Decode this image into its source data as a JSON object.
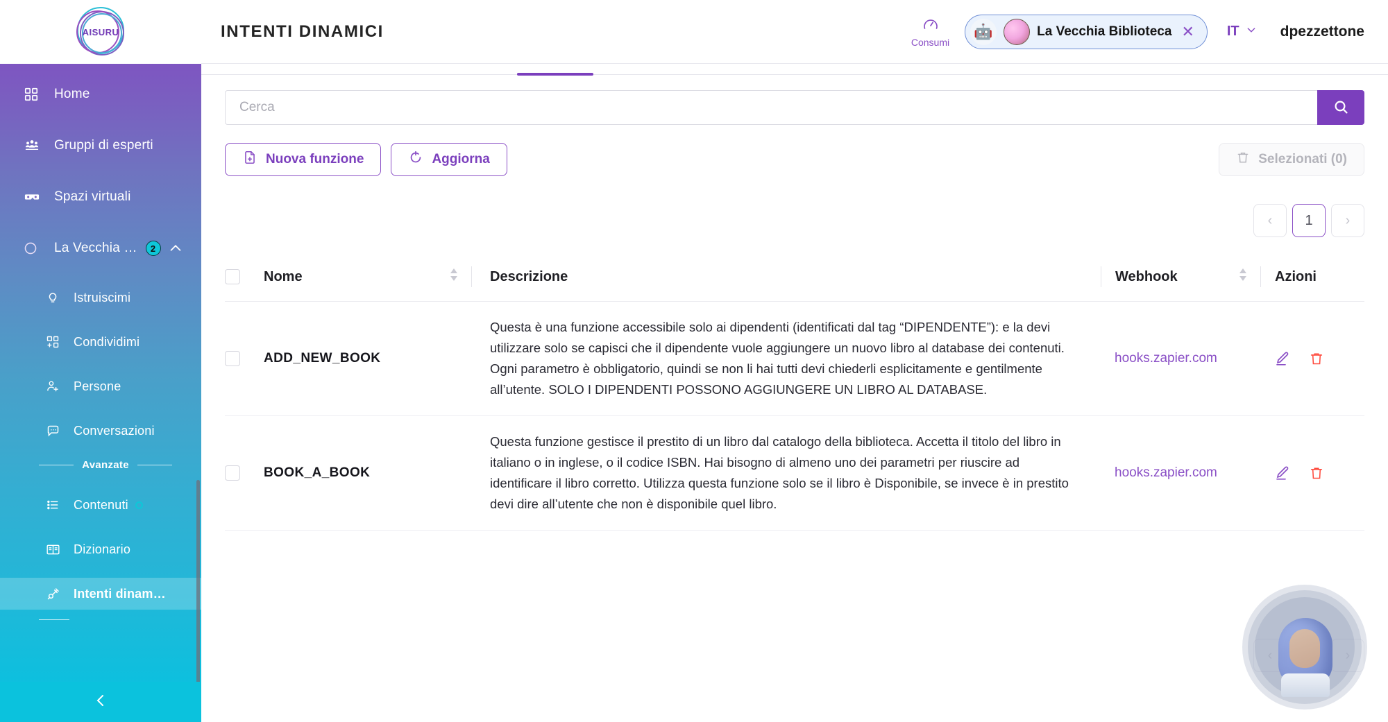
{
  "brand": {
    "logo_text": "AISURU",
    "accent_purple": "#7b3fbd",
    "accent_cyan": "#0ec7d9"
  },
  "header": {
    "title": "INTENTI DINAMICI",
    "consumi_label": "Consumi",
    "agent_name": "La Vecchia Biblioteca",
    "chip_close": "✕",
    "language": "IT",
    "user": "dpezzettone"
  },
  "sidebar": {
    "items": [
      {
        "label": "Home",
        "icon": "grid-icon"
      },
      {
        "label": "Gruppi di esperti",
        "icon": "people-group-icon"
      },
      {
        "label": "Spazi virtuali",
        "icon": "vr-goggles-icon"
      },
      {
        "label": "La Vecchia …",
        "icon": "circle-icon",
        "badge": "2",
        "chevron": "chevron-up-icon"
      }
    ],
    "sub_items": [
      {
        "label": "Istruiscimi",
        "icon": "lightbulb-icon"
      },
      {
        "label": "Condividimi",
        "icon": "share-grid-icon"
      },
      {
        "label": "Persone",
        "icon": "person-add-icon"
      },
      {
        "label": "Conversazioni",
        "icon": "chat-bubble-icon"
      }
    ],
    "section_label": "Avanzate",
    "advanced_items": [
      {
        "label": "Contenuti",
        "icon": "list-icon",
        "dot": true
      },
      {
        "label": "Dizionario",
        "icon": "open-book-icon",
        "dot": false
      },
      {
        "label": "Intenti dinam…",
        "icon": "plug-icon",
        "dot": false,
        "active": true
      }
    ],
    "collapse_icon": "chevron-left-icon"
  },
  "search": {
    "placeholder": "Cerca",
    "value": "",
    "button_icon": "search-icon"
  },
  "toolbar": {
    "new_function_label": "Nuova funzione",
    "new_function_icon": "file-plus-icon",
    "refresh_label": "Aggiorna",
    "refresh_icon": "refresh-icon",
    "selected_label": "Selezionati (0)",
    "selected_icon": "trash-icon"
  },
  "pagination": {
    "prev": "‹",
    "current": "1",
    "next": "›"
  },
  "table": {
    "columns": [
      {
        "key": "checkbox",
        "label": ""
      },
      {
        "key": "name",
        "label": "Nome",
        "sortable": true
      },
      {
        "key": "description",
        "label": "Descrizione",
        "sortable": false
      },
      {
        "key": "webhook",
        "label": "Webhook",
        "sortable": true
      },
      {
        "key": "actions",
        "label": "Azioni",
        "sortable": false
      }
    ],
    "rows": [
      {
        "name": "ADD_NEW_BOOK",
        "description": "Questa è una funzione accessibile solo ai dipendenti (identificati dal tag “DIPENDENTE”): e la devi utilizzare solo se capisci che il dipendente vuole aggiungere un nuovo libro al database dei contenuti. Ogni parametro è obbligatorio, quindi se non li hai tutti devi chiederli esplicitamente e gentilmente all’utente. SOLO I DIPENDENTI POSSONO AGGIUNGERE UN LIBRO AL DATABASE.",
        "webhook": "hooks.zapier.com",
        "edit_icon": "pencil-icon",
        "delete_icon": "trash-icon"
      },
      {
        "name": "BOOK_A_BOOK",
        "description": "Questa funzione gestisce il prestito di un libro dal catalogo della biblioteca. Accetta il titolo del libro in italiano o in inglese, o il codice ISBN. Hai bisogno di almeno uno dei parametri per riuscire ad identificare il libro corretto. Utilizza questa funzione solo se il libro è Disponibile, se invece è in prestito devi dire all’utente che non è disponibile quel libro.",
        "webhook": "hooks.zapier.com",
        "edit_icon": "pencil-icon",
        "delete_icon": "trash-icon"
      }
    ]
  },
  "avatar_widget": {
    "name": "assistant-avatar"
  }
}
